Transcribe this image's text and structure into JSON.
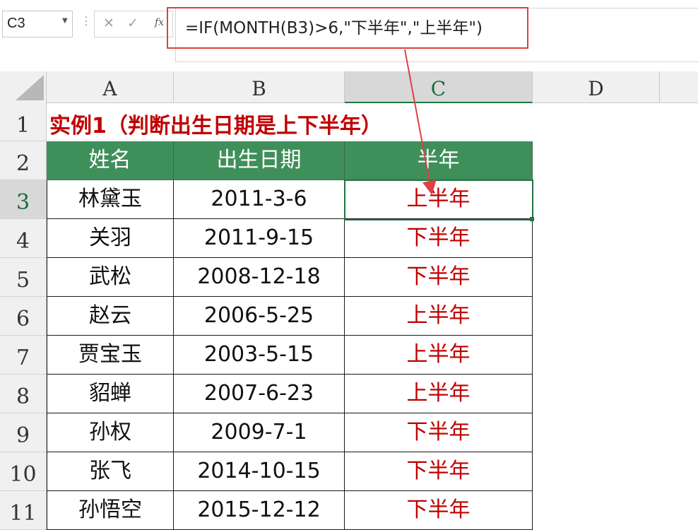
{
  "name_box": {
    "value": "C3"
  },
  "formula_bar": {
    "formula": "=IF(MONTH(B3)>6,\"下半年\",\"上半年\")"
  },
  "columns": [
    "A",
    "B",
    "C",
    "D"
  ],
  "title": "实例1（判断出生日期是上下半年）",
  "table": {
    "headers": [
      "姓名",
      "出生日期",
      "半年"
    ],
    "rows": [
      [
        "林黛玉",
        "2011-3-6",
        "上半年"
      ],
      [
        "关羽",
        "2011-9-15",
        "下半年"
      ],
      [
        "武松",
        "2008-12-18",
        "下半年"
      ],
      [
        "赵云",
        "2006-5-25",
        "上半年"
      ],
      [
        "贾宝玉",
        "2003-5-15",
        "上半年"
      ],
      [
        "貂蝉",
        "2007-6-23",
        "上半年"
      ],
      [
        "孙权",
        "2009-7-1",
        "下半年"
      ],
      [
        "张飞",
        "2014-10-15",
        "下半年"
      ],
      [
        "孙悟空",
        "2015-12-12",
        "下半年"
      ]
    ]
  },
  "row_numbers": [
    "1",
    "2",
    "3",
    "4",
    "5",
    "6",
    "7",
    "8",
    "9",
    "10",
    "11"
  ],
  "icons": {
    "cancel": "close-icon",
    "enter": "check-icon",
    "function": "fx-icon"
  },
  "colors": {
    "header_fill": "#3f8f5a",
    "result_text": "#c00000",
    "title_text": "#c00000",
    "annotation": "#e04040"
  }
}
